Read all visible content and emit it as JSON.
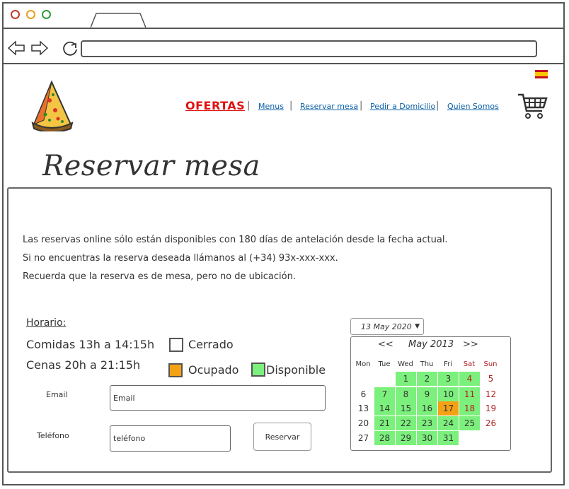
{
  "browser": {
    "url": ""
  },
  "nav": {
    "ofertas": "OFERTAS",
    "menus": "Menus",
    "reservar": "Reservar mesa",
    "pedir": "Pedir a Domicilio",
    "quien": "Quien Somos"
  },
  "page": {
    "title": "Reservar mesa"
  },
  "info": {
    "line1": "Las reservas online sólo están disponibles con 180 días de antelación desde la fecha actual.",
    "line2": "Si no encuentras la reserva deseada llámanos al (+34) 93x-xxx-xxx.",
    "line3": "Recuerda que la reserva es de mesa, pero no de ubicación."
  },
  "horario": {
    "title": "Horario:",
    "comidas": "Comidas 13h a 14:15h",
    "cenas": "Cenas 20h a 21:15h"
  },
  "legend": {
    "cerrado": "Cerrado",
    "ocupado": "Ocupado",
    "disponible": "Disponible",
    "colors": {
      "ocupado": "#f4a116",
      "disponible": "#7cf07c"
    }
  },
  "form": {
    "email_label": "Email",
    "email_value": "Email",
    "telefono_label": "Teléfono",
    "telefono_value": "teléfono",
    "submit": "Reservar"
  },
  "datepicker": {
    "selected": "13 May 2020",
    "prev": "<<",
    "next": ">>",
    "month": "May 2013",
    "weekdays": [
      "Mon",
      "Tue",
      "Wed",
      "Thu",
      "Fri",
      "Sat",
      "Sun"
    ],
    "days": [
      "1",
      "2",
      "3",
      "4",
      "5",
      "6",
      "7",
      "8",
      "9",
      "10",
      "11",
      "12",
      "13",
      "14",
      "15",
      "16",
      "17",
      "18",
      "19",
      "20",
      "21",
      "22",
      "23",
      "24",
      "25",
      "26",
      "27",
      "28",
      "29",
      "30",
      "31"
    ]
  }
}
